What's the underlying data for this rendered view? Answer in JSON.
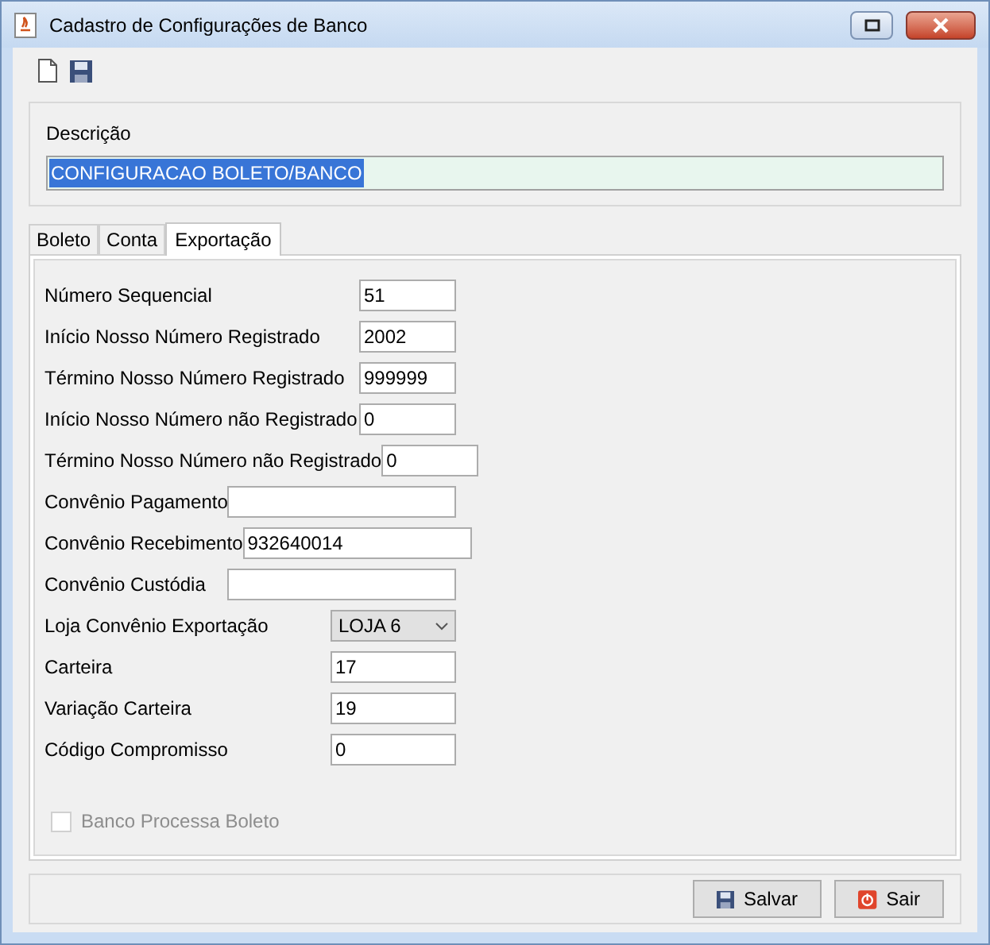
{
  "window": {
    "title": "Cadastro de Configurações de Banco"
  },
  "description": {
    "label": "Descrição",
    "value": "CONFIGURACAO BOLETO/BANCO"
  },
  "tabs": [
    {
      "label": "Boleto",
      "selected": false
    },
    {
      "label": "Conta",
      "selected": false
    },
    {
      "label": "Exportação",
      "selected": true
    }
  ],
  "field_groups": [
    [
      {
        "label": "Número Sequencial",
        "value": "51",
        "kind": "text"
      },
      {
        "label": "Início Nosso Número Registrado",
        "value": "2002",
        "kind": "text"
      },
      {
        "label": "Término Nosso Número Registrado",
        "value": "999999",
        "kind": "text"
      },
      {
        "label": "Início Nosso Número não Registrado",
        "value": "0",
        "kind": "text"
      },
      {
        "label": "Término Nosso Número não Registrado",
        "value": "0",
        "kind": "text"
      }
    ],
    [
      {
        "label": "Convênio Pagamento",
        "kind": "text"
      },
      {
        "label": "Convênio Recebimento",
        "value": "932640014",
        "kind": "text"
      },
      {
        "label": "Convênio Custódia",
        "kind": "text"
      }
    ],
    [
      {
        "label": "Loja Convênio Exportação",
        "value": "LOJA 6",
        "kind": "select"
      },
      {
        "label": "Carteira",
        "value": "17",
        "kind": "text"
      },
      {
        "label": "Variação Carteira",
        "value": "19",
        "kind": "text"
      },
      {
        "label": "Código Compromisso",
        "value": "0",
        "kind": "text"
      }
    ]
  ],
  "checkbox": {
    "label": "Banco Processa Boleto",
    "checked": false,
    "disabled": true
  },
  "buttons": [
    {
      "label": "Salvar",
      "kind": "save"
    },
    {
      "label": "Sair",
      "kind": "exit"
    }
  ]
}
